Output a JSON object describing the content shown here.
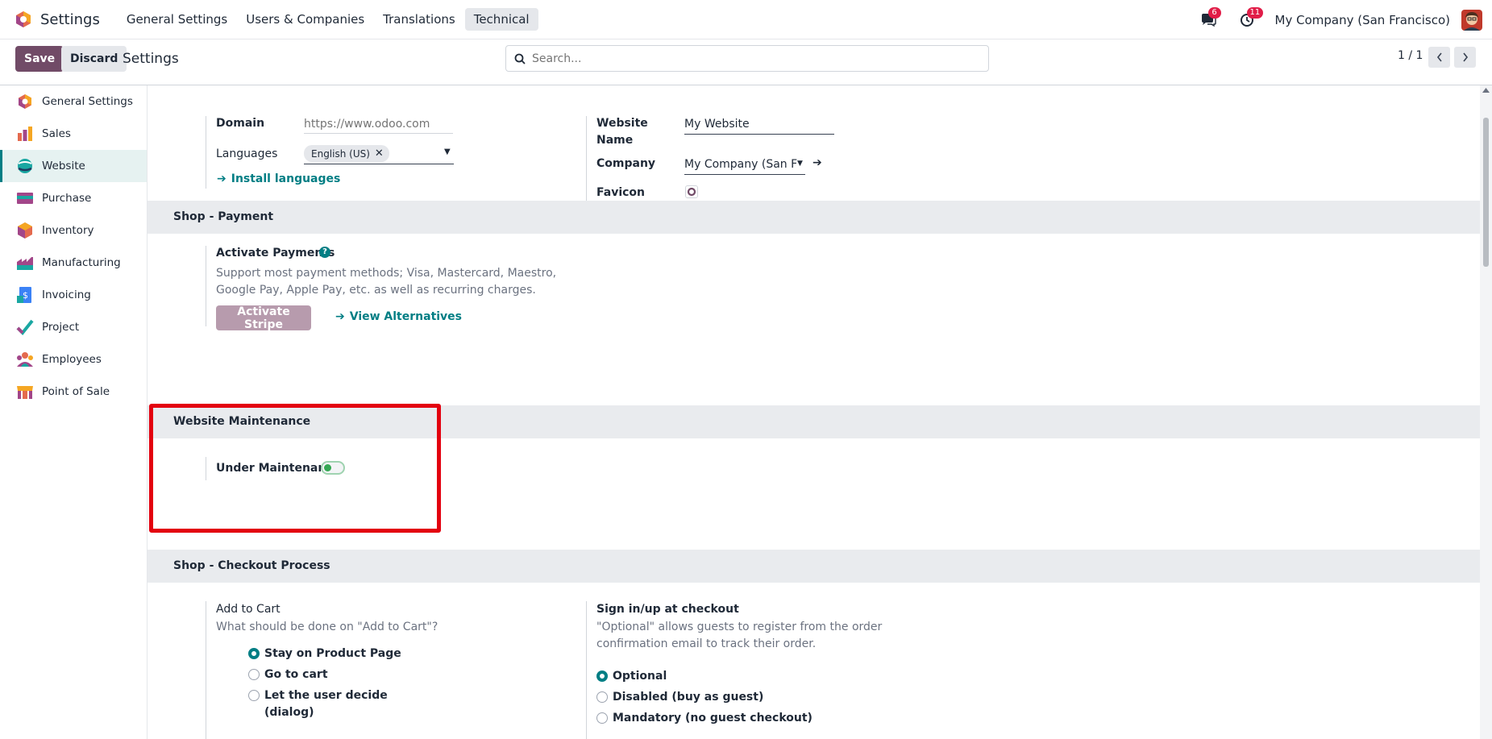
{
  "navbar": {
    "app_title": "Settings",
    "menu": [
      "General Settings",
      "Users & Companies",
      "Translations",
      "Technical"
    ],
    "active_menu": "Technical",
    "messages_count": "6",
    "activities_count": "11",
    "company": "My Company (San Francisco)"
  },
  "control_panel": {
    "save_label": "Save",
    "discard_label": "Discard",
    "title": "Settings",
    "search_placeholder": "Search...",
    "pager": "1 / 1"
  },
  "sidebar": {
    "items": [
      {
        "label": "General Settings",
        "icon": "general-settings-icon"
      },
      {
        "label": "Sales",
        "icon": "sales-icon"
      },
      {
        "label": "Website",
        "icon": "website-icon",
        "active": true
      },
      {
        "label": "Purchase",
        "icon": "purchase-icon"
      },
      {
        "label": "Inventory",
        "icon": "inventory-icon"
      },
      {
        "label": "Manufacturing",
        "icon": "manufacturing-icon"
      },
      {
        "label": "Invoicing",
        "icon": "invoicing-icon"
      },
      {
        "label": "Project",
        "icon": "project-icon"
      },
      {
        "label": "Employees",
        "icon": "employees-icon"
      },
      {
        "label": "Point of Sale",
        "icon": "point-of-sale-icon"
      }
    ]
  },
  "website_info": {
    "domain_label": "Domain",
    "domain_placeholder": "https://www.odoo.com",
    "languages_label": "Languages",
    "language_tag": "English (US)",
    "install_languages": "Install languages",
    "website_name_label_1": "Website",
    "website_name_label_2": "Name",
    "website_name_value": "My Website",
    "company_label": "Company",
    "company_value": "My Company (San Frar",
    "favicon_label": "Favicon"
  },
  "shop_payment": {
    "section_title": "Shop - Payment",
    "activate_payments_label": "Activate Payments",
    "description_line1": "Support most payment methods; Visa, Mastercard, Maestro,",
    "description_line2": "Google Pay, Apple Pay, etc. as well as recurring charges.",
    "activate_stripe": "Activate Stripe",
    "view_alternatives": "View Alternatives"
  },
  "maintenance": {
    "section_title": "Website Maintenance",
    "under_maintenance_label": "Under Maintenance",
    "enabled": false
  },
  "checkout": {
    "section_title": "Shop - Checkout Process",
    "add_to_cart_label": "Add to Cart",
    "add_to_cart_desc": "What should be done on \"Add to Cart\"?",
    "add_to_cart_options": [
      "Stay on Product Page",
      "Go to cart",
      "Let the user decide",
      "(dialog)"
    ],
    "add_to_cart_selected": "Stay on Product Page",
    "signin_label": "Sign in/up at checkout",
    "signin_desc_line1": "\"Optional\" allows guests to register from the order",
    "signin_desc_line2": "confirmation email to track their order.",
    "signin_options": [
      "Optional",
      "Disabled (buy as guest)",
      "Mandatory (no guest checkout)"
    ],
    "signin_selected": "Optional"
  },
  "colors": {
    "brand": "#714b67",
    "accent": "#017e84",
    "highlight": "#e3000f"
  }
}
